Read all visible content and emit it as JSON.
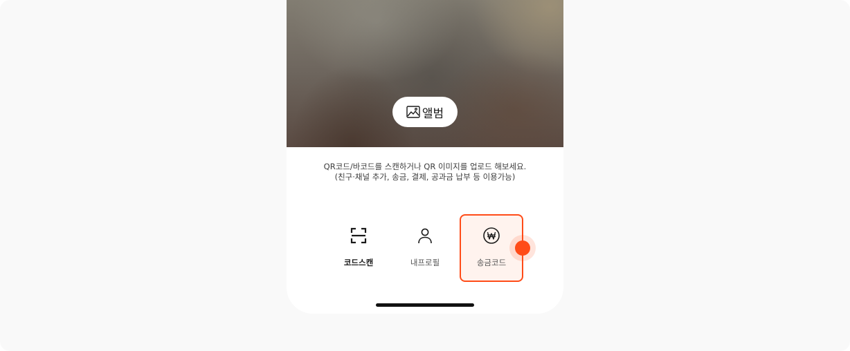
{
  "album_button": {
    "label": "앨범",
    "icon": "photo-icon"
  },
  "instructions": {
    "line1": "QR코드/바코드를 스캔하거나 QR 이미지를 업로드 해보세요.",
    "line2": "(친구·채널 추가, 송금, 결제, 공과금 납부 등 이용가능)"
  },
  "modes": [
    {
      "label": "코드스캔",
      "icon": "scan-frame-icon",
      "selected": false
    },
    {
      "label": "내프로필",
      "icon": "person-icon",
      "selected": false
    },
    {
      "label": "송금코드",
      "icon": "won-coin-icon",
      "selected": true
    }
  ],
  "colors": {
    "accent": "#ff4b17",
    "selected_background": "#fff3ee",
    "page_background": "#f9f9f9"
  }
}
